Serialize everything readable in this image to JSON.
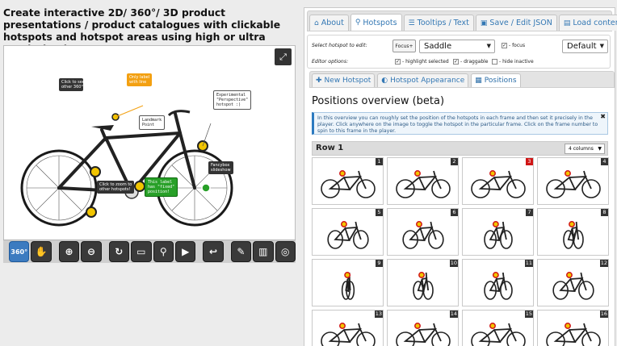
{
  "headline": "Create interactive 2D/ 360°/ 3D product presentations / product catalogues with clickable hotspots and hotspot areas using high or ultra resolution images!",
  "viewer": {
    "hotspot_labels": {
      "see_360": "Click to see\nother 360°",
      "only_label": "Only label\nwith line",
      "perspective": "Experimental\n\"Perspective\"\nhotspot :)",
      "landmark": "Landmark\nPoint",
      "fixed": "This label\nhas \"fixed\"\nposition!",
      "zoom": "Click to zoom to\nother hotspots!",
      "fancybox": "Fancybox\nslideshow"
    },
    "toolbar": {
      "mode_360": "360°"
    }
  },
  "tabs": [
    {
      "label": "About",
      "icon": "home-icon"
    },
    {
      "label": "Hotspots",
      "icon": "marker-icon"
    },
    {
      "label": "Tooltips / Text",
      "icon": "list-icon"
    },
    {
      "label": "Save / Edit JSON",
      "icon": "save-icon"
    },
    {
      "label": "Load content",
      "icon": "folder-icon"
    }
  ],
  "editor": {
    "select_label": "Select hotspot to edit:",
    "focus_button": "Focus+",
    "hotspot_value": "Saddle",
    "focus_check": "- focus",
    "style_value": "Default",
    "options_label": "Editor options:",
    "opt_highlight": "- highlight selected",
    "opt_draggable": "- draggable",
    "opt_hide": "- hide inactive"
  },
  "subtabs": [
    {
      "label": "New Hotspot",
      "icon": "plus-icon"
    },
    {
      "label": "Hotspot Appearance",
      "icon": "palette-icon"
    },
    {
      "label": "Positions",
      "icon": "grid-icon"
    }
  ],
  "positions": {
    "title": "Positions overview (beta)",
    "info": "In this overview you can roughly set the position of the hotspots in each frame and then set it precisely in the player. Click anywhere on the image to toggle the hotspot in the particular frame. Click on the frame number to spin to this frame in the player.",
    "row_title": "Row 1",
    "columns_value": "4 columns",
    "current_frame": 3,
    "frames": [
      {
        "num": "1",
        "angle": 0
      },
      {
        "num": "2",
        "angle": 0
      },
      {
        "num": "3",
        "angle": 0
      },
      {
        "num": "4",
        "angle": 0
      },
      {
        "num": "5",
        "angle": 1
      },
      {
        "num": "6",
        "angle": 1
      },
      {
        "num": "7",
        "angle": 2
      },
      {
        "num": "8",
        "angle": 3
      },
      {
        "num": "9",
        "angle": 4
      },
      {
        "num": "10",
        "angle": 3
      },
      {
        "num": "11",
        "angle": 2
      },
      {
        "num": "12",
        "angle": 1
      },
      {
        "num": "13",
        "angle": 0
      },
      {
        "num": "14",
        "angle": 0
      },
      {
        "num": "15",
        "angle": 0
      },
      {
        "num": "16",
        "angle": 0
      }
    ]
  },
  "colors": {
    "accent": "#3478b4",
    "hotspot_red": "#d01515",
    "hotspot_yellow": "#f2c500"
  }
}
